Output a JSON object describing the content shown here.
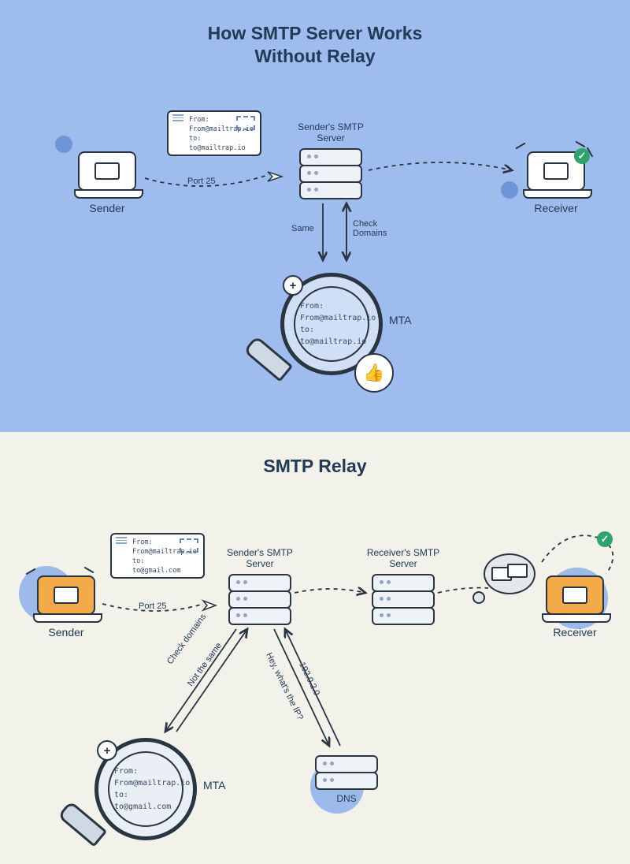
{
  "top": {
    "title": "How SMTP Server Works\nWithout Relay",
    "sender_label": "Sender",
    "receiver_label": "Receiver",
    "port_label": "Port 25",
    "server_label": "Sender's SMTP\nServer",
    "arrow_up_label": "Same",
    "arrow_down_label": "Check\nDomains",
    "mta_label": "MTA",
    "mag_from_label": "From:",
    "mag_from_value": "From@mailtrap.io",
    "mag_to_label": "to:",
    "mag_to_value": "to@mailtrap.io",
    "card_from_label": "From:",
    "card_from_value": "From@mailtrap.io",
    "card_to_label": "to:",
    "card_to_value": "to@mailtrap.io"
  },
  "bot": {
    "title": "SMTP Relay",
    "sender_label": "Sender",
    "receiver_label": "Receiver",
    "port_label": "Port 25",
    "server1_label": "Sender's SMTP\nServer",
    "server2_label": "Receiver's SMTP\nServer",
    "dns_label": "DNS",
    "mta_label": "MTA",
    "lbl_check": "Check domains",
    "lbl_notsame": "Not the same",
    "lbl_ipq": "Hey, what's the IP?",
    "lbl_ip": "192.0.2.0",
    "card_from_label": "From:",
    "card_from_value": "From@mailtrap.io",
    "card_to_label": "to:",
    "card_to_value": "to@gmail.com",
    "mag_from_label": "From:",
    "mag_from_value": "From@mailtrap.io",
    "mag_to_label": "to:",
    "mag_to_value": "to@gmail.com"
  }
}
